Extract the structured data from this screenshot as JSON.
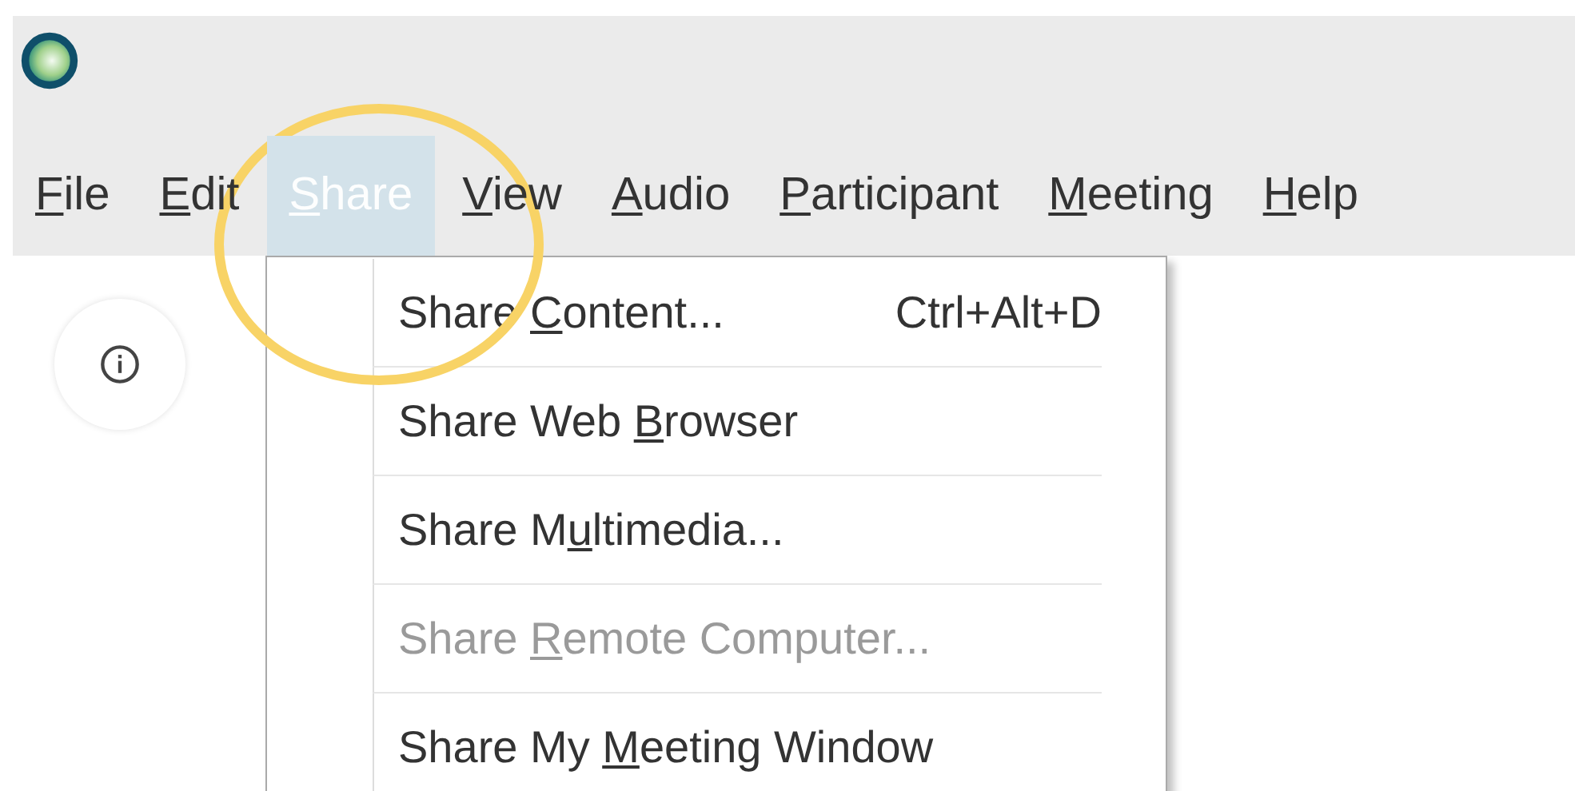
{
  "menu_bar": [
    {
      "key": "F",
      "after": "ile",
      "selected": false
    },
    {
      "key": "E",
      "after": "dit",
      "selected": false
    },
    {
      "key": "S",
      "after": "hare",
      "selected": true
    },
    {
      "key": "V",
      "after": "iew",
      "selected": false
    },
    {
      "key": "A",
      "after": "udio",
      "selected": false
    },
    {
      "key": "P",
      "after": "articipant",
      "selected": false
    },
    {
      "key": "M",
      "after": "eeting",
      "selected": false
    },
    {
      "key": "H",
      "after": "elp",
      "selected": false
    }
  ],
  "share_menu": [
    {
      "before": "Share ",
      "key": "C",
      "after": "ontent...",
      "shortcut": "Ctrl+Alt+D",
      "disabled": false
    },
    {
      "before": "Share Web ",
      "key": "B",
      "after": "rowser",
      "disabled": false
    },
    {
      "before": "Share M",
      "key": "u",
      "after": "ltimedia...",
      "disabled": false
    },
    {
      "before": "Share ",
      "key": "R",
      "after": "emote Computer...",
      "disabled": true
    },
    {
      "before": "Share My ",
      "key": "M",
      "after": "eeting Window",
      "disabled": false
    }
  ]
}
